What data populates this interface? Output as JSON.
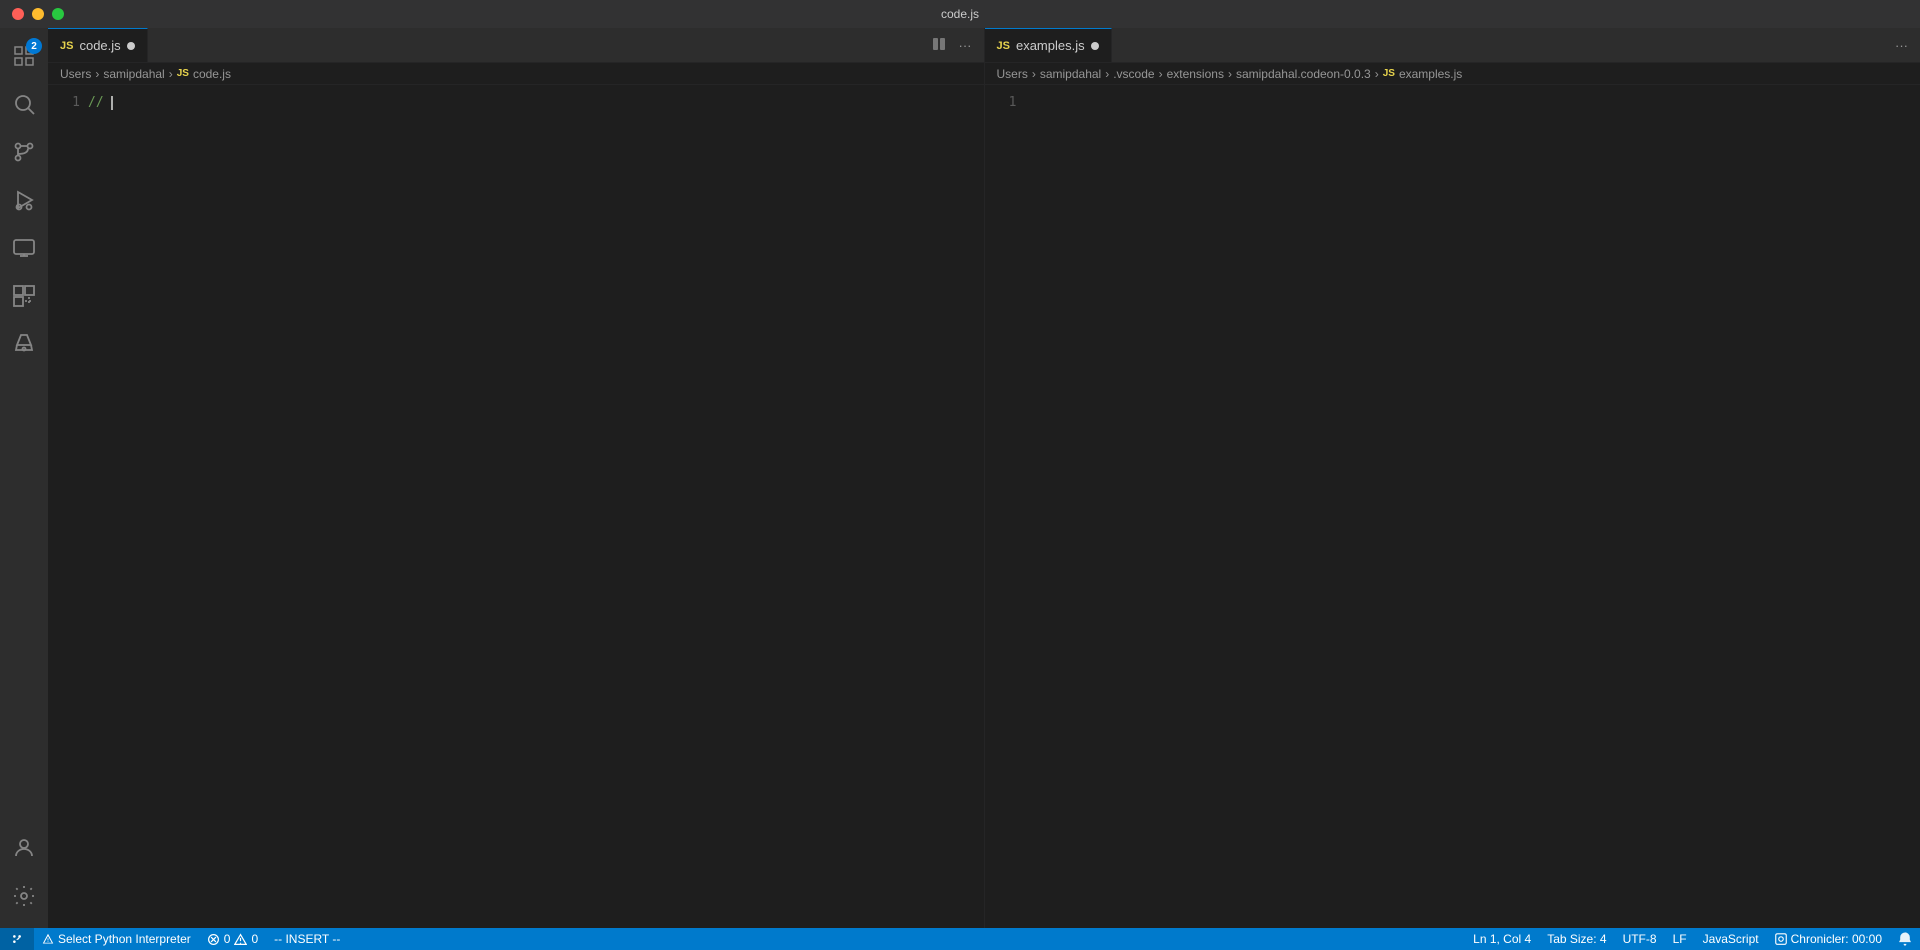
{
  "titleBar": {
    "title": "code.js"
  },
  "activityBar": {
    "icons": [
      {
        "name": "explorer-icon",
        "label": "Explorer",
        "active": false,
        "badge": "2"
      },
      {
        "name": "search-icon",
        "label": "Search",
        "active": false
      },
      {
        "name": "source-control-icon",
        "label": "Source Control",
        "active": false
      },
      {
        "name": "run-debug-icon",
        "label": "Run and Debug",
        "active": false
      },
      {
        "name": "remote-explorer-icon",
        "label": "Remote Explorer",
        "active": false
      },
      {
        "name": "extensions-icon",
        "label": "Extensions",
        "active": false
      },
      {
        "name": "testing-icon",
        "label": "Testing",
        "active": false
      }
    ],
    "bottomIcons": [
      {
        "name": "account-icon",
        "label": "Account"
      },
      {
        "name": "settings-icon",
        "label": "Settings"
      }
    ]
  },
  "leftPane": {
    "tab": {
      "icon": "JS",
      "filename": "code.js",
      "dirty": true
    },
    "breadcrumb": {
      "parts": [
        "Users",
        "samipdahal",
        "code.js"
      ],
      "iconLabel": "JS"
    },
    "editor": {
      "lineNumber": "1",
      "code": "// "
    }
  },
  "rightPane": {
    "tab": {
      "icon": "JS",
      "filename": "examples.js",
      "dirty": true
    },
    "breadcrumb": {
      "parts": [
        "Users",
        "samipdahal",
        ".vscode",
        "extensions",
        "samipdahal.codeon-0.0.3",
        "examples.js"
      ],
      "iconLabel": "JS"
    },
    "editor": {
      "lineNumber": "1",
      "code": ""
    }
  },
  "statusBar": {
    "gitBranch": "",
    "pythonInterpreter": "Select Python Interpreter",
    "errors": "0",
    "warnings": "0",
    "mode": "-- INSERT --",
    "position": "Ln 1, Col 4",
    "tabSize": "Tab Size: 4",
    "encoding": "UTF-8",
    "lineEnding": "LF",
    "language": "JavaScript",
    "extension": "Chronicler: 00:00",
    "notifIcon": "🔔"
  }
}
